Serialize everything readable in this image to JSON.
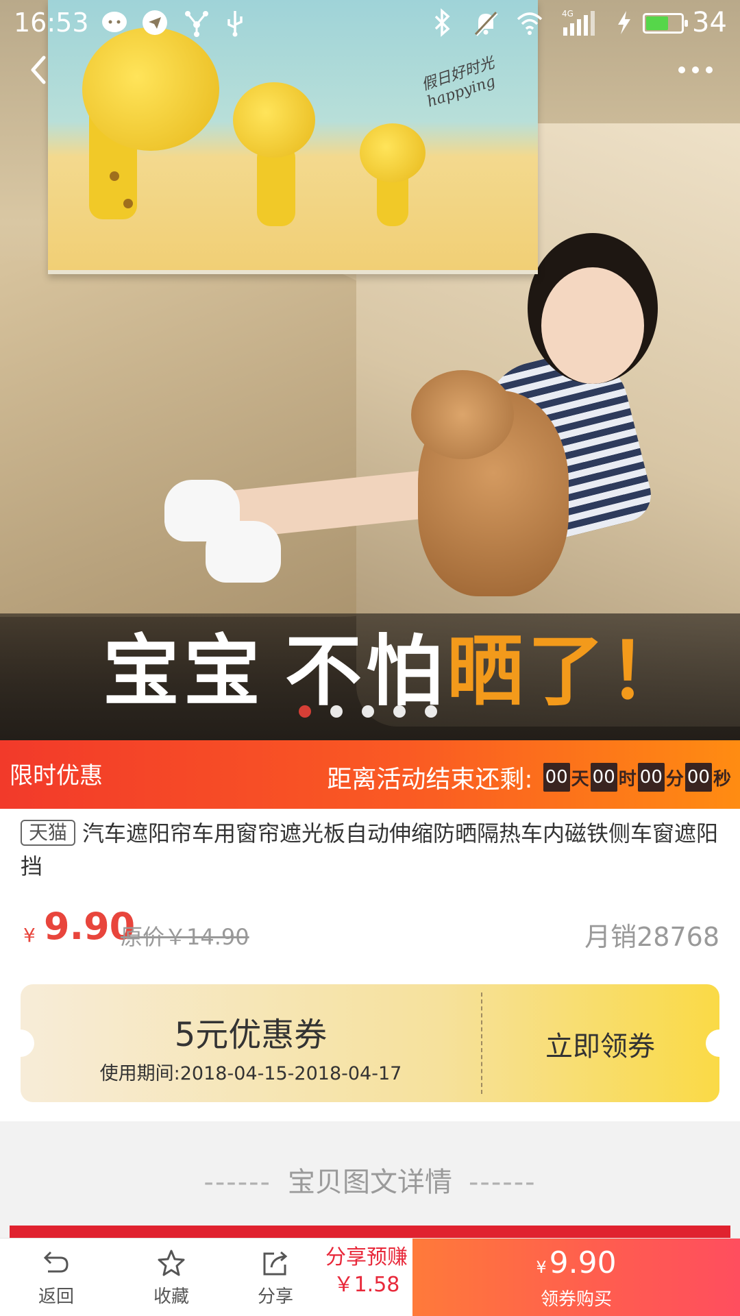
{
  "status_bar": {
    "time": "16:53",
    "battery_level": "34",
    "network": "4G"
  },
  "hero": {
    "caption_part1": "宝宝",
    "caption_part2": "不怕",
    "caption_part3": "晒了！",
    "shade_text": "假日好时光 happying",
    "slide_count": 5,
    "active_slide": 1
  },
  "flash_sale": {
    "label": "限时优惠",
    "countdown_prefix": "距离活动结束还剩:",
    "days": "00",
    "days_unit": "天",
    "hours": "00",
    "hours_unit": "时",
    "minutes": "00",
    "minutes_unit": "分",
    "seconds": "00",
    "seconds_unit": "秒"
  },
  "product": {
    "store_tag": "天猫",
    "title": "汽车遮阳帘车用窗帘遮光板自动伸缩防晒隔热车内磁铁侧车窗遮阳挡",
    "currency": "¥",
    "price": "9.90",
    "original_price": "原价￥14.90",
    "monthly_sales": "月销28768"
  },
  "coupon": {
    "amount": "5元优惠券",
    "period": "使用期间:2018-04-15-2018-04-17",
    "claim_label": "立即领券"
  },
  "details": {
    "dash_left": "------",
    "title": "宝贝图文详情",
    "dash_right": "------"
  },
  "bottom_bar": {
    "back_label": "返回",
    "favorite_label": "收藏",
    "share_label": "分享",
    "share_earn_label": "分享预赚",
    "share_earn_amount": "￥1.58",
    "buy_currency": "¥",
    "buy_price": "9.90",
    "buy_label": "领券购买"
  },
  "colors": {
    "accent_red": "#e8453c",
    "flash_start": "#f23a2a",
    "flash_end": "#ff8c12",
    "buy_button": "#ff5c50",
    "coupon_yellow": "#fada46"
  },
  "icons": [
    "back-arrow-icon",
    "more-dots-icon",
    "return-icon",
    "star-icon",
    "share-icon",
    "bluetooth-icon",
    "mute-icon",
    "wifi-icon",
    "signal-icon",
    "battery-icon"
  ]
}
